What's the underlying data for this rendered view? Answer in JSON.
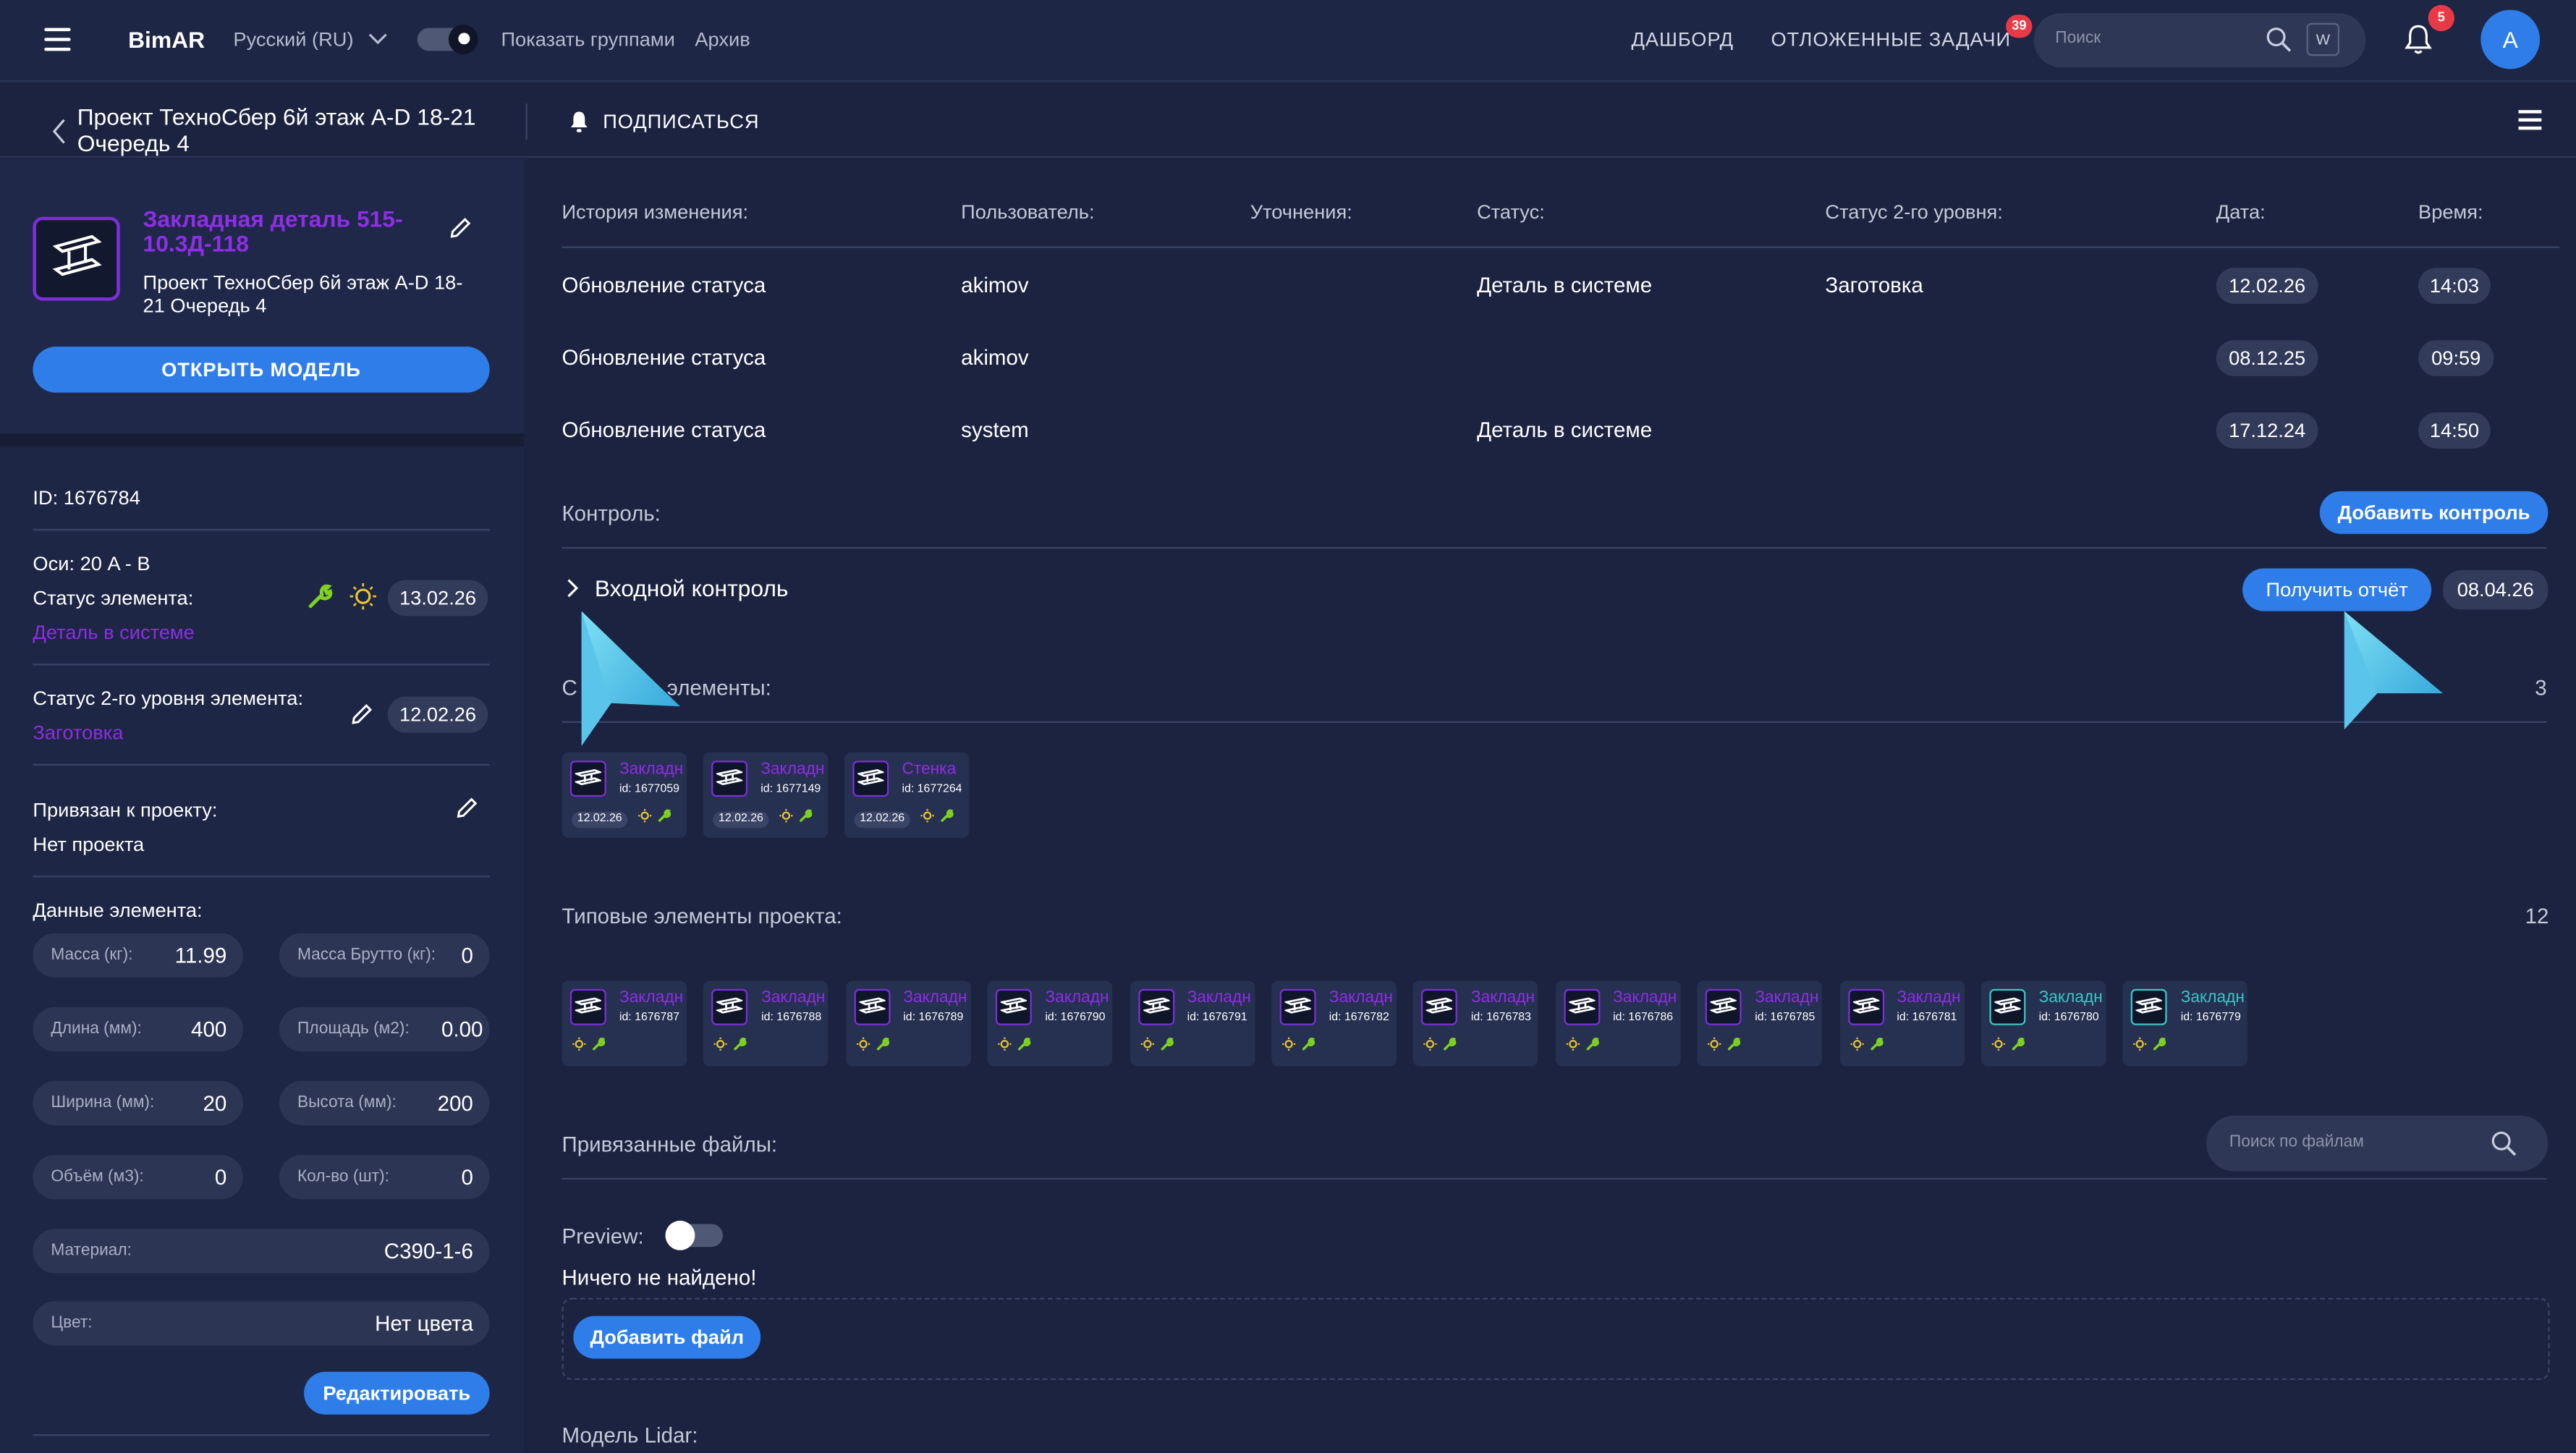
{
  "topbar": {
    "logo": "BimAR",
    "language": "Русский (RU)",
    "show_groups": "Показать группами",
    "archive": "Архив",
    "nav_dashboard": "ДАШБОРД",
    "nav_deferred": "ОТЛОЖЕННЫЕ ЗАДАЧИ",
    "deferred_badge": "39",
    "search_placeholder": "Поиск",
    "search_shortcut": "W",
    "bell_badge": "5",
    "avatar": "A"
  },
  "subbar": {
    "project_title": "Проект ТехноСбер 6й этаж A-D 18-21 Очередь 4",
    "subscribe": "ПОДПИСАТЬСЯ"
  },
  "element": {
    "name": "Закладная деталь 515-10.3Д-118",
    "project": "Проект ТехноСбер 6й этаж A-D 18-21 Очередь 4",
    "open_model": "ОТКРЫТЬ МОДЕЛЬ",
    "id_line": "ID: 1676784",
    "axes_line": "Оси: 20 A - B",
    "status_label": "Статус элемента:",
    "status_value": "Деталь в системе",
    "status_date": "13.02.26",
    "status2_label": "Статус 2-го уровня элемента:",
    "status2_value": "Заготовка",
    "status2_date": "12.02.26",
    "project_link_label": "Привязан к проекту:",
    "project_link_value": "Нет проекта",
    "data_title": "Данные элемента:",
    "fields": [
      {
        "label": "Масса (кг):",
        "value": "11.99"
      },
      {
        "label": "Масса Брутто (кг):",
        "value": "0"
      },
      {
        "label": "Длина (мм):",
        "value": "400"
      },
      {
        "label": "Площадь (м2):",
        "value": "0.00"
      },
      {
        "label": "Ширина (мм):",
        "value": "20"
      },
      {
        "label": "Высота (мм):",
        "value": "200"
      },
      {
        "label": "Объём (м3):",
        "value": "0"
      },
      {
        "label": "Кол-во (шт):",
        "value": "0"
      },
      {
        "label": "Материал:",
        "value": "C390-1-6"
      },
      {
        "label": "Цвет:",
        "value": "Нет цвета"
      }
    ],
    "edit_button": "Редактировать"
  },
  "history": {
    "headers": [
      "История изменения:",
      "Пользователь:",
      "Уточнения:",
      "Статус:",
      "Статус 2-го уровня:",
      "Дата:",
      "Время:"
    ],
    "rows": [
      {
        "change": "Обновление статуса",
        "user": "akimov",
        "note": "",
        "status": "Деталь в системе",
        "status2": "Заготовка",
        "date": "12.02.26",
        "time": "14:03"
      },
      {
        "change": "Обновление статуса",
        "user": "akimov",
        "note": "",
        "status": "",
        "status2": "",
        "date": "08.12.25",
        "time": "09:59"
      },
      {
        "change": "Обновление статуса",
        "user": "system",
        "note": "",
        "status": "Деталь в системе",
        "status2": "",
        "date": "17.12.24",
        "time": "14:50"
      }
    ]
  },
  "control": {
    "title": "Контроль:",
    "add_button": "Добавить контроль",
    "entry": "Входной контроль",
    "report_button": "Получить отчёт",
    "entry_date": "08.04.26"
  },
  "related": {
    "title_left": "С",
    "title_right": "элементы:",
    "count": "3",
    "items": [
      {
        "name": "Закладн",
        "id": "id: 1677059",
        "date": "12.02.26",
        "teal": false
      },
      {
        "name": "Закладн",
        "id": "id: 1677149",
        "date": "12.02.26",
        "teal": false
      },
      {
        "name": "Стенка",
        "id": "id: 1677264",
        "date": "12.02.26",
        "teal": false
      }
    ]
  },
  "typical": {
    "title": "Типовые элементы проекта:",
    "count": "12",
    "items": [
      {
        "name": "Закладн",
        "id": "id: 1676787",
        "teal": false
      },
      {
        "name": "Закладн",
        "id": "id: 1676788",
        "teal": false
      },
      {
        "name": "Закладн",
        "id": "id: 1676789",
        "teal": false
      },
      {
        "name": "Закладн",
        "id": "id: 1676790",
        "teal": false
      },
      {
        "name": "Закладн",
        "id": "id: 1676791",
        "teal": false
      },
      {
        "name": "Закладн",
        "id": "id: 1676782",
        "teal": false
      },
      {
        "name": "Закладн",
        "id": "id: 1676783",
        "teal": false
      },
      {
        "name": "Закладн",
        "id": "id: 1676786",
        "teal": false
      },
      {
        "name": "Закладн",
        "id": "id: 1676785",
        "teal": false
      },
      {
        "name": "Закладн",
        "id": "id: 1676781",
        "teal": false
      },
      {
        "name": "Закладн",
        "id": "id: 1676780",
        "teal": true
      },
      {
        "name": "Закладн",
        "id": "id: 1676779",
        "teal": true
      }
    ]
  },
  "files": {
    "title": "Привязанные файлы:",
    "search_placeholder": "Поиск по файлам",
    "preview_label": "Preview:",
    "empty": "Ничего не найдено!",
    "add_button": "Добавить файл"
  },
  "lidar": {
    "title": "Модель Lidar:"
  },
  "colors": {
    "accent": "#2f7de9",
    "purple": "#8b2fe0",
    "teal": "#3ac6c6",
    "badge": "#e83a46",
    "wrench": "#7ed321",
    "bulb": "#e8c530"
  }
}
